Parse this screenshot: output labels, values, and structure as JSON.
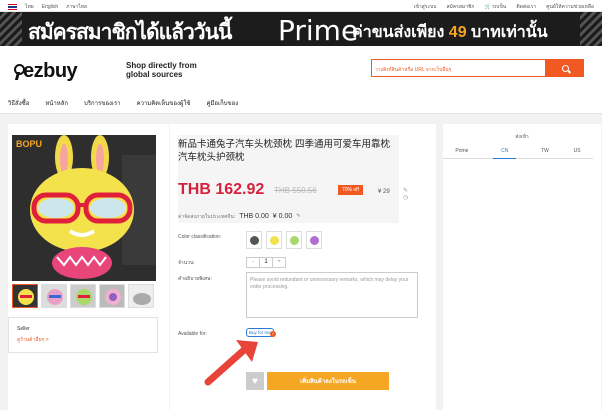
{
  "topbar": {
    "lang_thai": "ไทย",
    "lang_en": "English",
    "lang_other": "ภาษาไทย",
    "login": "เข้าสู่ระบบ",
    "register": "สมัครสมาชิก",
    "cart": "รถเข็น",
    "orders": "ติดต่อเรา",
    "help": "ศูนย์ให้ความช่วยเหลือ"
  },
  "banner": {
    "text1": "สมัครสมาชิกได้แล้ววันนี้",
    "prime": "Prime",
    "text3": "ค่าขนส่งเพียง",
    "num": "49",
    "text4": "บาทเท่านั้น"
  },
  "header": {
    "logo": "ezbuy",
    "tagline": "Shop directly from global sources",
    "search_placeholder": "วางลิงก์สินค้าหรือ URL จากเว็บอื่นๆ"
  },
  "nav": [
    "วิธีสั่งซื้อ",
    "หน้าหลัก",
    "บริการของเรา",
    "ความคิดเห็นของผู้ใช้",
    "คู่มือเก็บของ"
  ],
  "seller": {
    "label": "Seller",
    "name": "ดูร้านค้าอื่นๆ >"
  },
  "product": {
    "title": "新品卡通兔子汽车头枕颈枕 四季通用可爱车用靠枕汽车枕头护颈枕",
    "price": "THB 162.92",
    "old_price": "THB 550.56",
    "discount": "70% off",
    "cny": "¥ 29",
    "ship_label": "ค่าจัดส่งภายในประเทศจีน:",
    "ship_thb": "THB 0.00",
    "ship_cny": "¥ 0.00",
    "color_label": "Color classification:",
    "qty_label": "จำนวน:",
    "qty": "1",
    "remark_label": "คำอธิบายพิเศษ:",
    "remark_placeholder": "Please avoid redundant or unnecessary remarks, which may delay your order processing.",
    "available_label": "Available for:",
    "buy_for_me": "Buy for me",
    "cart_button": "เพิ่มสินค้าลงในรถเข็น"
  },
  "ship_to": {
    "label": "ส่งเข้า",
    "tabs": [
      "Prime",
      "CN",
      "TW",
      "US"
    ],
    "active": "CN"
  }
}
